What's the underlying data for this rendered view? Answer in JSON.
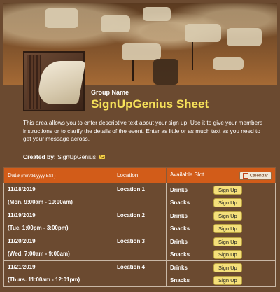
{
  "header": {
    "group_label": "Group Name",
    "title": "SignUpGenius Sheet",
    "description": "This area allows you to enter descriptive text about your sign up. Use it to give your members instructions or to clarify the details of the event. Enter as little or as much text as you need to get your message across.",
    "created_by_label": "Created by:",
    "created_by_value": "SignUpGenius"
  },
  "table": {
    "col_date": "Date",
    "col_date_note": "(mm/dd/yyyy EST)",
    "col_location": "Location",
    "col_slot": "Available Slot",
    "calendar_label": "Calendar",
    "signup_label": "Sign Up",
    "rows": [
      {
        "date": "11/18/2019",
        "time": "(Mon. 9:00am - 10:00am)",
        "location": "Location 1",
        "slots": [
          "Drinks",
          "Snacks"
        ]
      },
      {
        "date": "11/19/2019",
        "time": "(Tue. 1:00pm - 3:00pm)",
        "location": "Location 2",
        "slots": [
          "Drinks",
          "Snacks"
        ]
      },
      {
        "date": "11/20/2019",
        "time": "(Wed. 7:00am - 9:00am)",
        "location": "Location 3",
        "slots": [
          "Drinks",
          "Snacks"
        ]
      },
      {
        "date": "11/21/2019",
        "time": "(Thurs. 11:00am - 12:01pm)",
        "location": "Location 4",
        "slots": [
          "Drinks",
          "Snacks"
        ]
      }
    ]
  },
  "colors": {
    "background": "#6b4a30",
    "header_orange": "#d25c19",
    "title_yellow": "#f7e25a",
    "button_yellow": "#f5e07a"
  }
}
